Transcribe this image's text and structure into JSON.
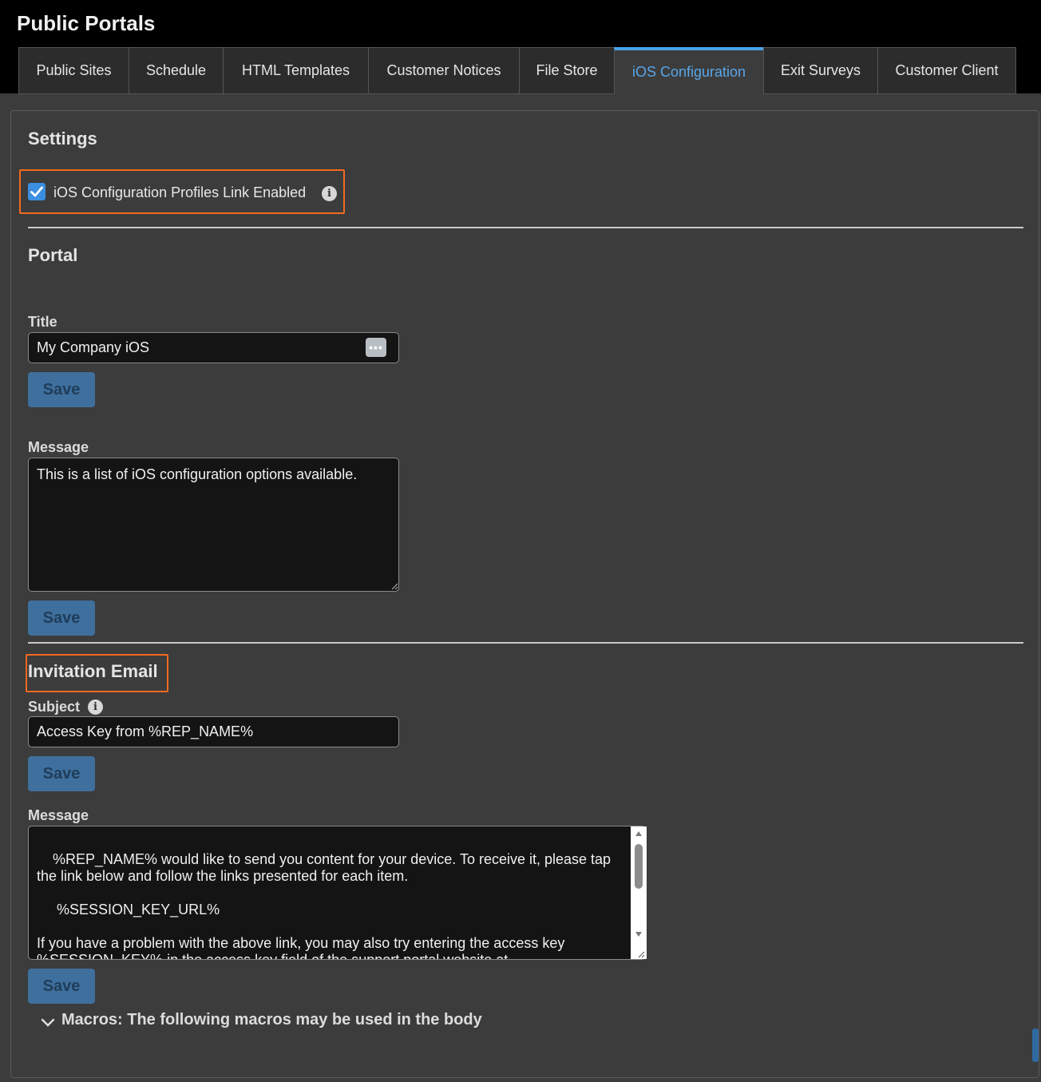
{
  "header": {
    "title": "Public Portals"
  },
  "tabs": [
    {
      "label": "Public Sites"
    },
    {
      "label": "Schedule"
    },
    {
      "label": "HTML Templates"
    },
    {
      "label": "Customer Notices"
    },
    {
      "label": "File Store"
    },
    {
      "label": "iOS Configuration"
    },
    {
      "label": "Exit Surveys"
    },
    {
      "label": "Customer Client"
    }
  ],
  "active_tab": "iOS Configuration",
  "settings": {
    "heading": "Settings",
    "checkbox_label": "iOS Configuration Profiles Link Enabled",
    "checked": true
  },
  "portal": {
    "heading": "Portal",
    "title_label": "Title",
    "title_value": "My Company iOS",
    "save_label": "Save",
    "message_label": "Message",
    "message_value": "This is a list of iOS configuration options available."
  },
  "invitation": {
    "heading": "Invitation Email",
    "subject_label": "Subject",
    "subject_value": "Access Key from %REP_NAME%",
    "save_label": "Save",
    "message_label": "Message",
    "message_value": "%REP_NAME% would like to send you content for your device. To receive it, please tap the link below and follow the links presented for each item.\n\n     %SESSION_KEY_URL%\n\nIf you have a problem with the above link, you may also try entering the access key %SESSION_KEY% in the access key field of the support portal website at %PUBLIC_SITE_URL% using your device."
  },
  "macros": {
    "label": "Macros: The following macros may be used in the body"
  },
  "colors": {
    "accent": "#4aa3ea",
    "highlight": "#f26a21",
    "button": "#3f6f9d"
  },
  "icons": [
    "checkmark-icon",
    "info-icon",
    "more-dots-icon",
    "chevron-down-icon",
    "scroll-up-arrow-icon",
    "scroll-down-arrow-icon",
    "resize-grip-icon"
  ]
}
